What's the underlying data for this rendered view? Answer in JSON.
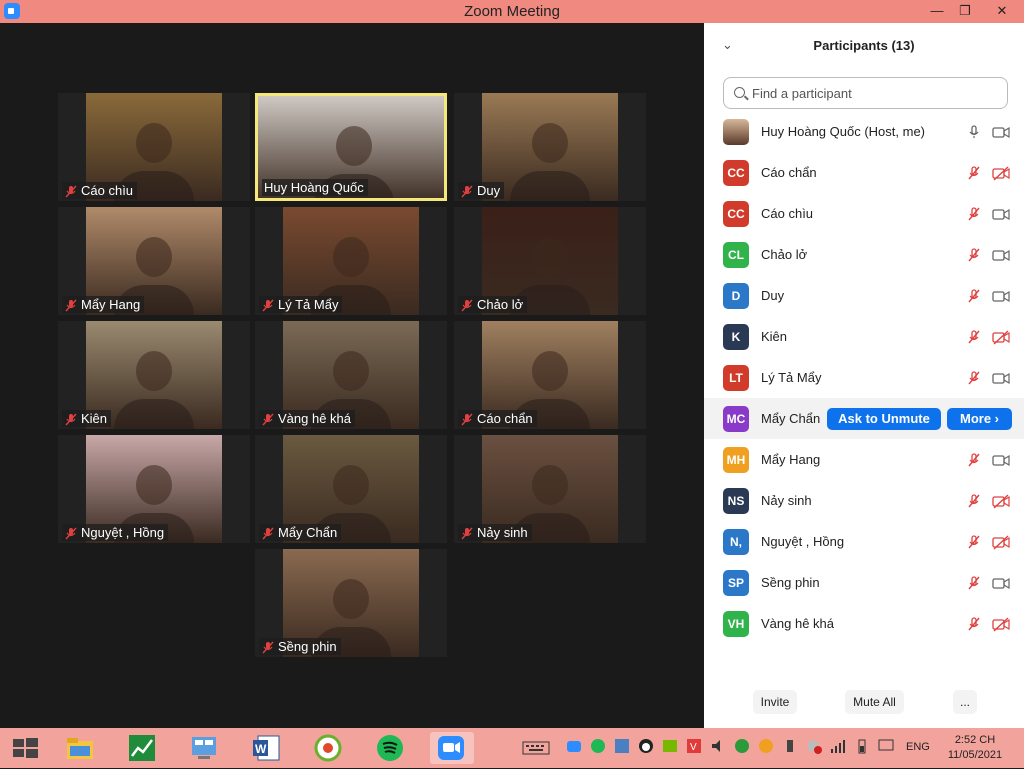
{
  "window": {
    "title": "Zoom Meeting",
    "min": "—",
    "max": "❐",
    "close": "✕"
  },
  "tiles": [
    {
      "name": "Cáo chìu",
      "muted": true,
      "bg": "#8a6a3a"
    },
    {
      "name": "Huy Hoàng Quốc",
      "muted": false,
      "bg": "#cfc9c3",
      "active": true
    },
    {
      "name": "Duy",
      "muted": true,
      "bg": "#9a7a55"
    },
    {
      "name": "Mẩy Hang",
      "muted": true,
      "bg": "#b08a6a"
    },
    {
      "name": "Lý Tả Mẩy",
      "muted": true,
      "bg": "#7a4a30"
    },
    {
      "name": "Chảo lở",
      "muted": true,
      "bg": "#3a2018"
    },
    {
      "name": "Kiên",
      "muted": true,
      "bg": "#9a8a70"
    },
    {
      "name": "Vàng hê khá",
      "muted": true,
      "bg": "#7a6a55"
    },
    {
      "name": "Cáo chẩn",
      "muted": true,
      "bg": "#a08060"
    },
    {
      "name": "Nguyệt , Hồng",
      "muted": true,
      "bg": "#c8a8a8"
    },
    {
      "name": "Mẩy Chẩn",
      "muted": true,
      "bg": "#6a5a40"
    },
    {
      "name": "Nảy sinh",
      "muted": true,
      "bg": "#6a5040"
    },
    {
      "name": "Sềng phin",
      "muted": true,
      "bg": "#8a6a50"
    }
  ],
  "panel": {
    "title": "Participants (13)",
    "collapse_icon": "⌄",
    "search_placeholder": "Find a participant",
    "participants": [
      {
        "initials": "",
        "name": "Huy Hoàng Quốc (Host, me)",
        "color": "#8a6a4a",
        "mic_muted": false,
        "cam_off": false
      },
      {
        "initials": "CC",
        "name": "Cáo chẩn",
        "color": "#d13b2b",
        "mic_muted": true,
        "cam_off": true
      },
      {
        "initials": "CC",
        "name": "Cáo chìu",
        "color": "#d13b2b",
        "mic_muted": true,
        "cam_off": false
      },
      {
        "initials": "CL",
        "name": "Chảo lở",
        "color": "#2fb34a",
        "mic_muted": true,
        "cam_off": false
      },
      {
        "initials": "D",
        "name": "Duy",
        "color": "#2b78c8",
        "mic_muted": true,
        "cam_off": false
      },
      {
        "initials": "K",
        "name": "Kiên",
        "color": "#2a3a55",
        "mic_muted": true,
        "cam_off": true
      },
      {
        "initials": "LT",
        "name": "Lý Tả Mẩy",
        "color": "#d13b2b",
        "mic_muted": true,
        "cam_off": false
      },
      {
        "initials": "MC",
        "name": "Mẩy Chẩn",
        "color": "#8a3ac8",
        "mic_muted": true,
        "cam_off": false,
        "hover": true
      },
      {
        "initials": "MH",
        "name": "Mẩy Hang",
        "color": "#f0a020",
        "mic_muted": true,
        "cam_off": false
      },
      {
        "initials": "NS",
        "name": "Nảy sinh",
        "color": "#2a3a55",
        "mic_muted": true,
        "cam_off": true
      },
      {
        "initials": "N,",
        "name": "Nguyệt , Hồng",
        "color": "#2b78c8",
        "mic_muted": true,
        "cam_off": true
      },
      {
        "initials": "SP",
        "name": "Sềng phin",
        "color": "#2b78c8",
        "mic_muted": true,
        "cam_off": false
      },
      {
        "initials": "VH",
        "name": "Vàng hê khá",
        "color": "#2fb34a",
        "mic_muted": true,
        "cam_off": true
      }
    ],
    "ask_unmute": "Ask to Unmute",
    "more": "More ›",
    "invite": "Invite",
    "mute_all": "Mute All",
    "ellipsis": "..."
  },
  "taskbar": {
    "lang": "ENG",
    "time": "2:52 CH",
    "date": "11/05/2021"
  }
}
